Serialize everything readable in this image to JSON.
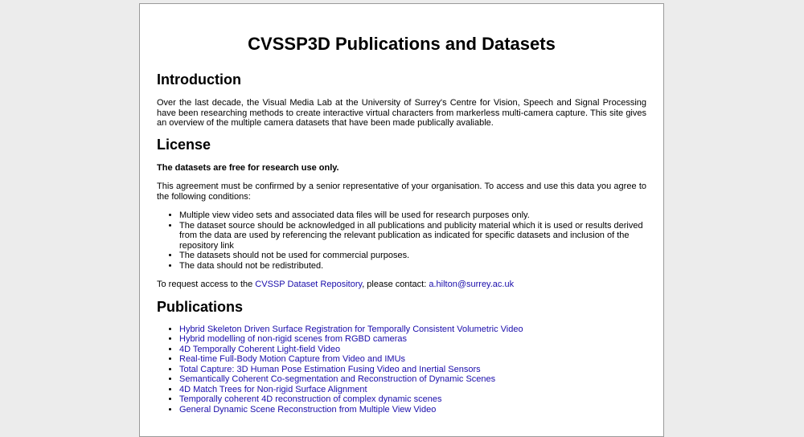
{
  "title": "CVSSP3D Publications and Datasets",
  "intro": {
    "heading": "Introduction",
    "text": "Over the last decade, the Visual Media Lab at the University of Surrey's Centre for Vision, Speech and Signal Processing have been researching methods to create interactive virtual characters from markerless multi-camera capture. This site gives an overview of the multiple camera datasets that have been made publically avaliable."
  },
  "license": {
    "heading": "License",
    "bold_note": "The datasets are free for research use only.",
    "agreement": "This agreement must be confirmed by a senior representative of your organisation. To access and use this data you agree to the following conditions:",
    "conditions": [
      "Multiple view video sets and associated data files will be used for research purposes only.",
      "The dataset source should be acknowledged in all publications and publicity material which it is used or results derived from the data are used by referencing the relevant publication as indicated for specific datasets and inclusion of the repository link",
      "The datasets should not be used for commercial purposes.",
      "The data should not be redistributed."
    ],
    "access_prefix": "To request access to the ",
    "repo_link": "CVSSP Dataset Repository",
    "access_middle": ", please contact: ",
    "email_link": "a.hilton@surrey.ac.uk"
  },
  "publications": {
    "heading": "Publications",
    "items": [
      "Hybrid Skeleton Driven Surface Registration for Temporally Consistent Volumetric Video",
      "Hybrid modelling of non-rigid scenes from RGBD cameras",
      "4D Temporally Coherent Light-field Video",
      "Real-time Full-Body Motion Capture from Video and IMUs",
      "Total Capture: 3D Human Pose Estimation Fusing Video and Inertial Sensors",
      "Semantically Coherent Co-segmentation and Reconstruction of Dynamic Scenes",
      "4D Match Trees for Non-rigid Surface Alignment",
      "Temporally coherent 4D reconstruction of complex dynamic scenes",
      "General Dynamic Scene Reconstruction from Multiple View Video"
    ]
  },
  "colors": {
    "link": "#1a0dab",
    "page_bg": "#ffffff",
    "outer_bg": "#ececec"
  }
}
